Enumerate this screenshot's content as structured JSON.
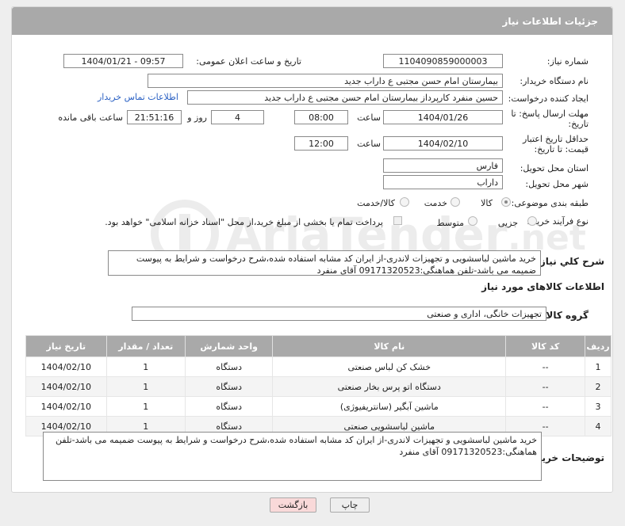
{
  "header": {
    "title": "جزئیات اطلاعات نیاز"
  },
  "labels": {
    "need_no": "شماره نیاز:",
    "announce": "تاریخ و ساعت اعلان عمومی:",
    "buyer_org": "نام دستگاه خریدار:",
    "requester": "ایجاد کننده درخواست:",
    "contact_link": "اطلاعات تماس خریدار",
    "deadline": "مهلت ارسال پاسخ: تا تاریخ:",
    "time": "ساعت",
    "days_and": "روز و",
    "remaining": "ساعت باقی مانده",
    "validity": "حداقل تاریخ اعتبار قیمت: تا تاریخ:",
    "province": "استان محل تحویل:",
    "city": "شهر محل تحویل:",
    "category": "طبقه بندی موضوعی:",
    "process": "نوع فرآیند خرید :",
    "payment_note": "پرداخت تمام یا بخشی از مبلغ خرید،از محل \"اسناد خزانه اسلامی\" خواهد بود.",
    "desc": "شرح کلي نياز:",
    "goods_info": "اطلاعات کالاهای مورد نیاز",
    "goods_group": "گروه کالا:",
    "buyer_notes": "توضیحات خریدار:"
  },
  "values": {
    "need_no": "1104090859000003",
    "announce": "1404/01/21 - 09:57",
    "buyer_org": "بیمارستان امام حسن مجتبی  ع  داراب جدید",
    "requester": "حسین  منفرد کارپرداز بیمارستان امام حسن مجتبی  ع  داراب جدید",
    "deadline_date": "1404/01/26",
    "deadline_time": "08:00",
    "days": "4",
    "remaining_time": "21:51:16",
    "validity_date": "1404/02/10",
    "validity_time": "12:00",
    "province": "فارس",
    "city": "داراب",
    "desc": "خرید ماشین لباسشویی و تجهیزات لاندری-از ایران کد مشابه استفاده شده،شرح درخواست و شرایط به پیوست ضمیمه می باشد-تلفن هماهنگی:09171320523 آقای منفرد",
    "goods_group": "تجهیزات خانگی، اداری و صنعتی",
    "buyer_notes": "خرید ماشین لباسشویی و تجهیزات لاندری-از ایران کد مشابه استفاده شده،شرح درخواست و شرایط به پیوست ضمیمه می باشد-تلفن هماهنگی:09171320523 آقای منفرد"
  },
  "category_options": [
    "کالا",
    "خدمت",
    "کالا/خدمت"
  ],
  "category_selected": "کالا",
  "process_options": [
    "جزیی",
    "متوسط"
  ],
  "table": {
    "headers": [
      "ردیف",
      "کد کالا",
      "نام کالا",
      "واحد شمارش",
      "تعداد / مقدار",
      "تاریخ نیاز"
    ],
    "rows": [
      [
        "1",
        "--",
        "خشک کن لباس صنعتی",
        "دستگاه",
        "1",
        "1404/02/10"
      ],
      [
        "2",
        "--",
        "دستگاه اتو پرس بخار صنعتی",
        "دستگاه",
        "1",
        "1404/02/10"
      ],
      [
        "3",
        "--",
        "ماشین آبگیر (سانتریفیوژی)",
        "دستگاه",
        "1",
        "1404/02/10"
      ],
      [
        "4",
        "--",
        "ماشین لباسشویی صنعتی",
        "دستگاه",
        "1",
        "1404/02/10"
      ]
    ]
  },
  "buttons": {
    "print": "چاپ",
    "back": "بازگشت"
  },
  "watermark": {
    "brand": "AriaTender",
    "tld": ".net"
  },
  "colors": {
    "header_bg": "#a9a9a9",
    "link": "#2c62c4",
    "back_btn": "#f9d9d9",
    "print_btn": "#eeeeee"
  }
}
